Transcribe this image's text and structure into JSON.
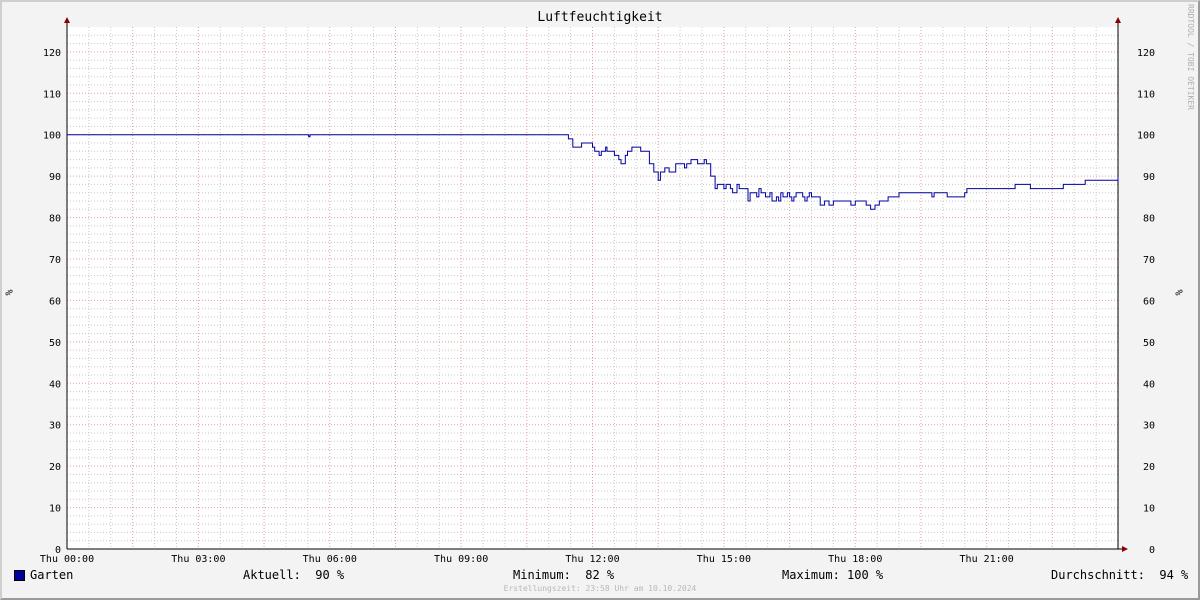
{
  "chart_data": {
    "type": "line",
    "title": "Luftfeuchtigkeit",
    "ylabel": "%",
    "ylim": [
      0,
      126
    ],
    "yticks": [
      0,
      10,
      20,
      30,
      40,
      50,
      60,
      70,
      80,
      90,
      100,
      110,
      120
    ],
    "xlim_hours": [
      0,
      24
    ],
    "xticks": [
      {
        "hour": 0,
        "label": "Thu 00:00"
      },
      {
        "hour": 3,
        "label": "Thu 03:00"
      },
      {
        "hour": 6,
        "label": "Thu 06:00"
      },
      {
        "hour": 9,
        "label": "Thu 09:00"
      },
      {
        "hour": 12,
        "label": "Thu 12:00"
      },
      {
        "hour": 15,
        "label": "Thu 15:00"
      },
      {
        "hour": 18,
        "label": "Thu 18:00"
      },
      {
        "hour": 21,
        "label": "Thu 21:00"
      }
    ],
    "grid": true,
    "series": [
      {
        "name": "Garten",
        "color": "#0000a0",
        "x_hours": [
          0,
          5.5,
          5.52,
          5.55,
          11.35,
          11.45,
          11.55,
          11.75,
          11.85,
          12.0,
          12.05,
          12.15,
          12.2,
          12.3,
          12.33,
          12.4,
          12.5,
          12.55,
          12.6,
          12.65,
          12.75,
          12.8,
          12.9,
          13.0,
          13.1,
          13.3,
          13.4,
          13.5,
          13.55,
          13.65,
          13.75,
          13.8,
          13.9,
          14.05,
          14.1,
          14.15,
          14.25,
          14.3,
          14.4,
          14.5,
          14.55,
          14.6,
          14.7,
          14.8,
          14.85,
          14.9,
          15.0,
          15.05,
          15.1,
          15.15,
          15.2,
          15.3,
          15.35,
          15.4,
          15.55,
          15.6,
          15.7,
          15.75,
          15.8,
          15.85,
          15.95,
          16.0,
          16.05,
          16.1,
          16.2,
          16.25,
          16.3,
          16.35,
          16.45,
          16.5,
          16.55,
          16.6,
          16.65,
          16.7,
          16.8,
          16.85,
          16.9,
          16.95,
          17.0,
          17.1,
          17.2,
          17.3,
          17.4,
          17.5,
          17.6,
          17.7,
          17.9,
          18.0,
          18.25,
          18.35,
          18.45,
          18.55,
          18.65,
          18.75,
          18.85,
          19.0,
          19.3,
          19.65,
          19.75,
          19.8,
          20.1,
          20.25,
          20.3,
          20.5,
          20.55,
          21.2,
          21.25,
          21.65,
          21.7,
          22.0,
          22.7,
          22.75,
          23.2,
          23.25,
          23.75,
          24.0
        ],
        "values": [
          100,
          100,
          99.5,
          100,
          100,
          99,
          97,
          98,
          98,
          97,
          96,
          95,
          96,
          97,
          96,
          96,
          95,
          95,
          94,
          93,
          95,
          96,
          97,
          97,
          96,
          93,
          91,
          89,
          91,
          92,
          91,
          91,
          93,
          93,
          92,
          93,
          94,
          94,
          93,
          93,
          94,
          93,
          90,
          87,
          88,
          88,
          87,
          88,
          88,
          87,
          86,
          88,
          87,
          87,
          84,
          86,
          86,
          85,
          87,
          86,
          85,
          85,
          86,
          84,
          85,
          84,
          86,
          85,
          86,
          85,
          84,
          85,
          86,
          86,
          85,
          84,
          85,
          86,
          85,
          85,
          83,
          84,
          83,
          84,
          84,
          84,
          83,
          84,
          83,
          82,
          83,
          84,
          84,
          85,
          85,
          86,
          86,
          86,
          85,
          86,
          85,
          85,
          85,
          86,
          87,
          87,
          87,
          88,
          88,
          87,
          87,
          88,
          88,
          89,
          89,
          90,
          90
        ]
      }
    ]
  },
  "legend": {
    "series_name": "Garten",
    "current_label": "Aktuell:",
    "current_value": "90 %",
    "min_label": "Minimum:",
    "min_value": "82 %",
    "max_label": "Maximum:",
    "max_value": "100 %",
    "avg_label": "Durchschnitt:",
    "avg_value": "94 %"
  },
  "watermark": "RRDTOOL / TOBI OETIKER",
  "footer": "Erstellungszeit: 23:58 Uhr am 10.10.2024",
  "colors": {
    "background": "#f3f3f3",
    "plot_bg": "#ffffff",
    "major_grid": "#e0a0a0",
    "minor_grid": "#c8c8c8",
    "axis": "#8b0000",
    "line": "#0000a0"
  }
}
